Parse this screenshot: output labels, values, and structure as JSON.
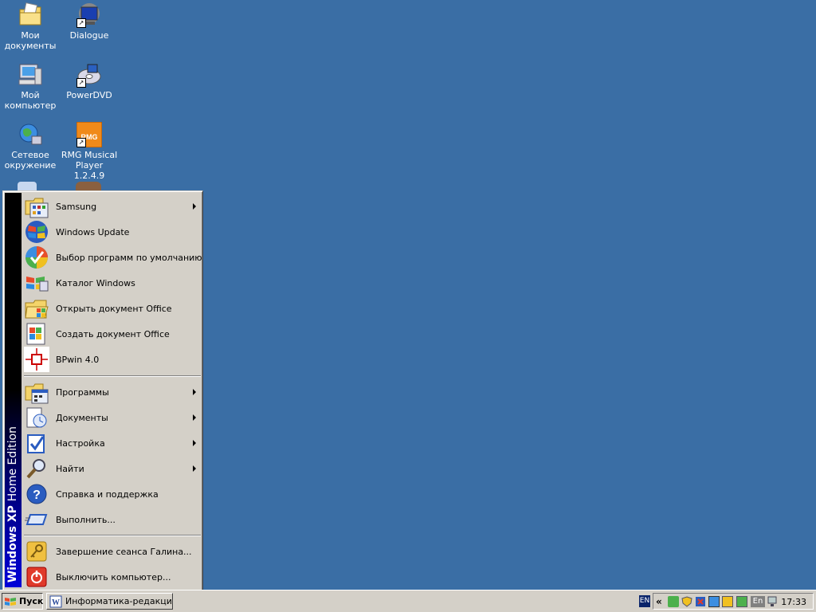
{
  "desktop": {
    "icons": [
      {
        "label": "Мои документы"
      },
      {
        "label": "Dialogue"
      },
      {
        "label": "Мой компьютер"
      },
      {
        "label": "PowerDVD"
      },
      {
        "label": "Сетевое окружение"
      },
      {
        "label": "RMG Musical Player 1.2.4.9"
      }
    ],
    "background_color": "#3a6ea5"
  },
  "start_menu": {
    "banner_bold": "Windows XP",
    "banner_light": "Home Edition",
    "top_items": [
      {
        "label": "Samsung",
        "icon": "program-group-icon",
        "submenu": true
      },
      {
        "label": "Windows Update",
        "icon": "windows-update-icon",
        "submenu": false
      },
      {
        "label": "Выбор программ по умолчанию",
        "icon": "default-programs-icon",
        "submenu": false
      },
      {
        "label": "Каталог Windows",
        "icon": "windows-catalog-icon",
        "submenu": false
      },
      {
        "label": "Открыть документ Office",
        "icon": "open-office-document-icon",
        "submenu": false
      },
      {
        "label": "Создать документ Office",
        "icon": "new-office-document-icon",
        "submenu": false
      },
      {
        "label": "BPwin 4.0",
        "icon": "bpwin-icon",
        "submenu": false
      }
    ],
    "main_items": [
      {
        "label": "Программы",
        "icon": "programs-icon",
        "submenu": true
      },
      {
        "label": "Документы",
        "icon": "documents-icon",
        "submenu": true
      },
      {
        "label": "Настройка",
        "icon": "settings-icon",
        "submenu": true
      },
      {
        "label": "Найти",
        "icon": "search-icon",
        "submenu": true
      },
      {
        "label": "Справка и поддержка",
        "icon": "help-icon",
        "submenu": false
      },
      {
        "label": "Выполнить...",
        "icon": "run-icon",
        "submenu": false
      }
    ],
    "bottom_items": [
      {
        "label": "Завершение сеанса Галина...",
        "icon": "logoff-icon"
      },
      {
        "label": "Выключить компьютер...",
        "icon": "shutdown-icon"
      }
    ]
  },
  "taskbar": {
    "start_label": "Пуск",
    "task_label": "Информатика-редакци...",
    "language": "EN",
    "tray_language": "En",
    "clock": "17:33"
  }
}
